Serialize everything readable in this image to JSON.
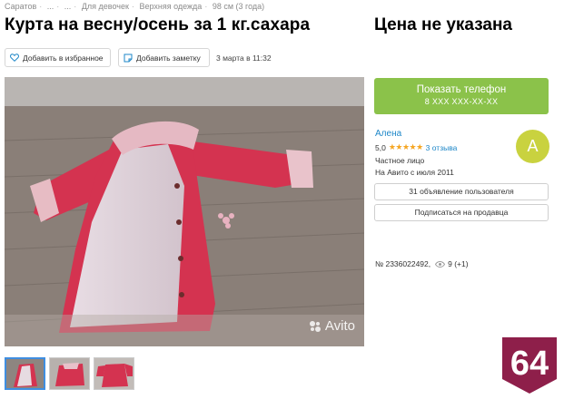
{
  "breadcrumb": [
    "Саратов",
    "...",
    "...",
    "Для девочек",
    "Верхняя одежда",
    "98 см (3 года)"
  ],
  "title": "Курта на весну/осень за 1 кг.сахара",
  "price": "Цена не указана",
  "actions": {
    "favorite_label": "Добавить в избранное",
    "note_label": "Добавить заметку",
    "posted_date": "3 марта в 11:32"
  },
  "photo": {
    "watermark": "Avito",
    "thumbnail_count": 3,
    "active_thumbnail": 1
  },
  "phone_button": {
    "label": "Показать телефон",
    "masked_number": "8 XXX XXX-XX-XX"
  },
  "seller": {
    "name": "Алена",
    "rating": "5,0",
    "stars": "★★★★★",
    "reviews": "3 отзыва",
    "type": "Частное лицо",
    "since": "На Авито с июля 2011",
    "avatar_letter": "А"
  },
  "buttons": {
    "user_ads": "31 объявление пользователя",
    "subscribe": "Подписаться на продавца"
  },
  "meta": {
    "ad_number": "№ 2336022492,",
    "views": "9 (+1)"
  },
  "badge": {
    "text": "64"
  },
  "colors": {
    "phone_button": "#8bc24a",
    "link": "#1e87c8",
    "star": "#f5a623",
    "avatar": "#c9d23f",
    "badge": "#8e1f4a",
    "coat": "#d43350"
  },
  "icons": {
    "favorite": "heart-icon",
    "note": "note-icon",
    "views": "eye-icon",
    "watermark": "avito-logo-icon"
  }
}
